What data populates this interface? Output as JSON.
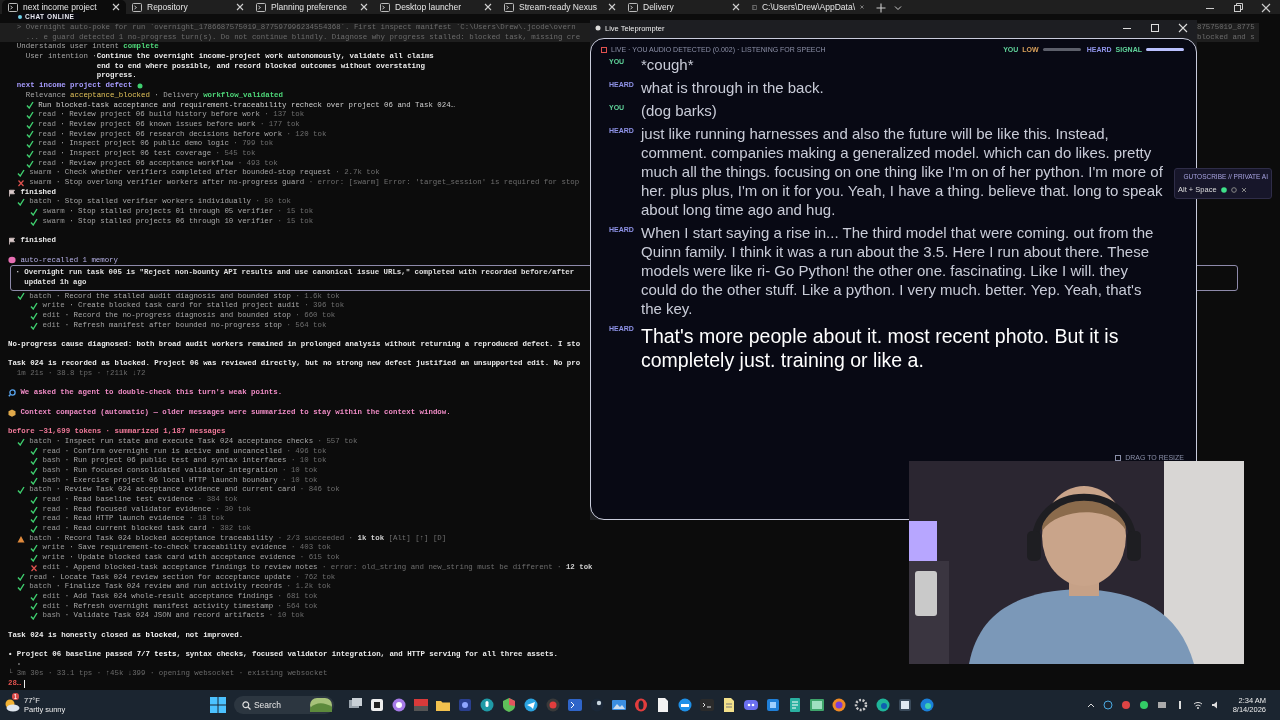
{
  "tabs": [
    {
      "label": "next income project",
      "selected": true
    },
    {
      "label": "Repository",
      "selected": false
    },
    {
      "label": "Planning preference",
      "selected": false
    },
    {
      "label": "Desktop launcher",
      "selected": false
    },
    {
      "label": "Stream-ready Nexus",
      "selected": false
    },
    {
      "label": "Delivery",
      "selected": false
    },
    {
      "label": "C:\\Users\\Drew\\AppData\\",
      "selected": false
    }
  ],
  "chat_badge": {
    "text": "CHAT ONLINE"
  },
  "terminal": {
    "lines": [
      {
        "kind": "prompt",
        "text": "> Overnight auto-poke for run `overnight_1786687575019_877597996234554368`. First inspect manifest `C:\\Users\\Drew\\.jcode\\overn"
      },
      {
        "kind": "prompt",
        "text": "  ... e guard detected 1 no-progress turn(s). Do not continue blindly. Diagnose why progress stalled: blocked task, missing cre"
      },
      {
        "kind": "intent",
        "label": "Understands user intent",
        "value": "complete"
      },
      {
        "kind": "intention",
        "label": "User intention ·",
        "text": "Continue the overnight income-project work autonomously, validate all claims end to end where possible, and record blocked outcomes without overstating progress."
      },
      {
        "kind": "defect",
        "text": "next income project defect"
      },
      {
        "kind": "relevance",
        "segments": [
          {
            "text": "Relevance",
            "kind": "label"
          },
          {
            "text": "acceptance_blocked",
            "kind": "warning"
          },
          {
            "text": "· Delivery",
            "kind": "label"
          },
          {
            "text": "workflow_validated",
            "kind": "success"
          }
        ]
      },
      {
        "kind": "group",
        "children": [
          {
            "kind": "done",
            "text": "Run blocked-task acceptance and requirement-traceability recheck over project 06 and Task 024…"
          },
          {
            "kind": "done",
            "tool": "read",
            "text": "· Review project 06 build history before work",
            "meta": "· 137 tok"
          },
          {
            "kind": "done",
            "tool": "read",
            "text": "· Review project 06 known issues before work",
            "meta": "· 177 tok"
          },
          {
            "kind": "done",
            "tool": "read",
            "text": "· Review project 06 research decisions before work",
            "meta": "· 120 tok"
          },
          {
            "kind": "done",
            "tool": "read",
            "text": "· Inspect project 06 public demo logic",
            "meta": "· 799 tok"
          },
          {
            "kind": "done",
            "tool": "read",
            "text": "· Inspect project 06 test coverage",
            "meta": "· 545 tok"
          },
          {
            "kind": "done",
            "tool": "read",
            "text": "· Review project 06 acceptance workflow",
            "meta": "· 493 tok"
          }
        ]
      },
      {
        "kind": "done",
        "tool": "swarm",
        "text": "· Check whether verifiers completed after bounded-stop request",
        "meta": "· 2.7k tok"
      },
      {
        "kind": "failed",
        "tool": "swarm",
        "text": "· Stop overlong verifier workers after no-progress guard",
        "meta": "· error: [swarm] Error: 'target_session' is required for stop"
      },
      {
        "kind": "finished",
        "text": "finished"
      },
      {
        "kind": "done",
        "tool": "batch",
        "text": "· Stop stalled verifier workers individually",
        "meta": "· 50 tok",
        "children": [
          {
            "kind": "done",
            "tool": "swarm",
            "text": "· Stop stalled projects 01 through 05 verifier",
            "meta": "· 15 tok"
          },
          {
            "kind": "done",
            "tool": "swarm",
            "text": "· Stop stalled projects 06 through 10 verifier",
            "meta": "· 15 tok"
          }
        ]
      },
      {
        "kind": "blank"
      },
      {
        "kind": "finished",
        "text": "finished"
      },
      {
        "kind": "blank"
      },
      {
        "kind": "memory_header",
        "text": "auto-recalled 1 memory"
      },
      {
        "kind": "memory_box",
        "lines": [
          "· Overnight run task 005 is \"Reject non-bounty API results and use canonical issue URLs,\" completed with recorded before/after",
          "  updated 1h ago"
        ]
      },
      {
        "kind": "done",
        "tool": "batch",
        "text": "· Record the stalled audit diagnosis and bounded stop",
        "meta": "· 1.6k tok",
        "children": [
          {
            "kind": "done",
            "tool": "write",
            "text": "· Create blocked task card for stalled project audit",
            "meta": "· 396 tok"
          },
          {
            "kind": "done",
            "tool": "edit",
            "text": "· Record the no-progress diagnosis and bounded stop",
            "meta": "· 660 tok"
          },
          {
            "kind": "done",
            "tool": "edit",
            "text": "· Refresh manifest after bounded no-progress stop",
            "meta": "· 564 tok"
          }
        ]
      },
      {
        "kind": "blank"
      },
      {
        "kind": "para",
        "text": "No-progress cause diagnosed: both broad audit workers remained in prolonged analysis without returning a reproduced defect. I sto"
      },
      {
        "kind": "blank"
      },
      {
        "kind": "para",
        "text": "Task 024 is recorded as blocked. Project 06 was reviewed directly, but no strong new defect justified an unsupported edit. No pro"
      },
      {
        "kind": "stats",
        "text": "1m 21s · 38.8 tps · ↑211k ↓72"
      },
      {
        "kind": "blank"
      },
      {
        "kind": "review_notice",
        "text": "We asked the agent to double-check this turn's weak points."
      },
      {
        "kind": "blank"
      },
      {
        "kind": "compact_notice",
        "text": "Context compacted (automatic) — older messages were summarized to stay within the context window."
      },
      {
        "kind": "blank"
      },
      {
        "kind": "summary",
        "text": "before ~31,699 tokens · summarized 1,187 messages"
      },
      {
        "kind": "done",
        "tool": "batch",
        "text": "· Inspect run state and execute Task 024 acceptance checks",
        "meta": "· 557 tok",
        "children": [
          {
            "kind": "done",
            "tool": "read",
            "text": "· Confirm overnight run is active and uncancelled",
            "meta": "· 496 tok"
          },
          {
            "kind": "done",
            "tool": "bash",
            "text": "· Run project 06 public test and syntax interfaces",
            "meta": "· 10 tok"
          },
          {
            "kind": "done",
            "tool": "bash",
            "text": "· Run focused consolidated validator integration",
            "meta": "· 10 tok"
          },
          {
            "kind": "done",
            "tool": "bash",
            "text": "· Exercise project 06 local HTTP launch boundary",
            "meta": "· 10 tok"
          }
        ]
      },
      {
        "kind": "done",
        "tool": "batch",
        "text": "· Review Task 024 acceptance evidence and current card",
        "meta": "· 846 tok",
        "children": [
          {
            "kind": "done",
            "tool": "read",
            "text": "· Read baseline test evidence",
            "meta": "· 384 tok"
          },
          {
            "kind": "done",
            "tool": "read",
            "text": "· Read focused validator evidence",
            "meta": "· 30 tok"
          },
          {
            "kind": "done",
            "tool": "read",
            "text": "· Read HTTP launch evidence",
            "meta": "· 18 tok"
          },
          {
            "kind": "done",
            "tool": "read",
            "text": "· Read current blocked task card",
            "meta": "· 382 tok"
          }
        ]
      },
      {
        "kind": "partial",
        "tool": "batch",
        "text": "· Record Task 024 blocked acceptance traceability",
        "meta": "· 2/3 succeeded · **1k tok** [Alt] [↑] [D]",
        "children": [
          {
            "kind": "done",
            "tool": "write",
            "text": "· Save requirement-to-check traceability evidence",
            "meta": "· 403 tok"
          },
          {
            "kind": "done",
            "tool": "write",
            "text": "· Update blocked task card with acceptance evidence",
            "meta": "· 615 tok"
          },
          {
            "kind": "failed",
            "tool": "edit",
            "text": "· Append blocked-task acceptance findings to review notes",
            "meta": "· error: old_string and new_string must be different · **12 tok**"
          }
        ]
      },
      {
        "kind": "done",
        "tool": "read",
        "text": "· Locate Task 024 review section for acceptance update",
        "meta": "· 762 tok"
      },
      {
        "kind": "done",
        "tool": "batch",
        "text": "· Finalize Task 024 review and run activity records",
        "meta": "· 1.2k tok",
        "children": [
          {
            "kind": "done",
            "tool": "edit",
            "text": "· Add Task 024 whole-result acceptance findings",
            "meta": "· 681 tok"
          },
          {
            "kind": "done",
            "tool": "edit",
            "text": "· Refresh overnight manifest activity timestamp",
            "meta": "· 564 tok"
          },
          {
            "kind": "done",
            "tool": "bash",
            "text": "· Validate Task 024 JSON and record artifacts",
            "meta": "· 10 tok"
          }
        ]
      },
      {
        "kind": "blank"
      },
      {
        "kind": "para",
        "text": "Task 024 is honestly closed as **blocked**, not improved."
      },
      {
        "kind": "blank"
      },
      {
        "kind": "para",
        "text": "• Project 06 baseline passed **7/7 tests**, syntax checks, focused validator integration, and HTTP serving for all three assets."
      },
      {
        "kind": "stats",
        "text": "•"
      },
      {
        "kind": "footer",
        "text": "└ 3m 30s · 33.1 tps · ↑45k ↓399 · opening websocket · existing websocket"
      },
      {
        "kind": "input",
        "text": "28…"
      }
    ]
  },
  "terminal_fragments": [
    "87575019_8775",
    "blocked and s"
  ],
  "teleprompter": {
    "title": "Live Teleprompter",
    "status": "LIVE · YOU AUDIO DETECTED (0.002) · LISTENING FOR SPEECH",
    "meters": [
      {
        "label": "YOU",
        "reading": "LOW",
        "color": "#d9a15a",
        "level": 0
      },
      {
        "label": "HEARD",
        "reading": "SIGNAL",
        "color": "#5fd39a",
        "level": 1
      }
    ],
    "transcript": [
      {
        "speaker": "YOU",
        "kind": "you",
        "text": "*cough*",
        "latest": false
      },
      {
        "speaker": "HEARD",
        "kind": "heard",
        "text": "what is through in the back.",
        "latest": false
      },
      {
        "speaker": "YOU",
        "kind": "you",
        "text": "(dog barks)",
        "latest": false
      },
      {
        "speaker": "HEARD",
        "kind": "heard",
        "text": "just like running harnesses and also the future will be like this. Instead, comment. companies making a generalized model. which can do likes. pretty much all the things. focusing on one thing like I'm on of her python. I'm more of her. plus plus, I'm on it for you. Yeah, I have a thing. believe that. long to speak about long time ago and hug.",
        "latest": false
      },
      {
        "speaker": "HEARD",
        "kind": "heard",
        "text": "When I start saying a rise in... The third model that were coming. out from the Quinn family. I think it was a run about the 3.5. Here I run about there. These models were like ri- Go Python! the other one. fascinating. Like I will. they could do the other stuff. Like a python. I very much. better. Yep. Yeah, that's the key.",
        "latest": false
      },
      {
        "speaker": "HEARD",
        "kind": "heard",
        "text": "That's more people about it. most recent photo. But it is completely just. training or like a.",
        "latest": true
      }
    ],
    "resize_hint": "DRAG TO RESIZE"
  },
  "hotkey_panel": {
    "title": "GUTOSCRIBE // PRIVATE AI",
    "shortcut": "Alt + Space",
    "online": true
  },
  "webcam": {
    "kind": "picture"
  },
  "taskbar": {
    "weather": {
      "badge": "1",
      "temp": "77°F",
      "condition": "Partly sunny"
    },
    "search": {
      "placeholder": "Search"
    },
    "clock": {
      "time": "2:34 AM",
      "date": "8/14/2026"
    }
  }
}
